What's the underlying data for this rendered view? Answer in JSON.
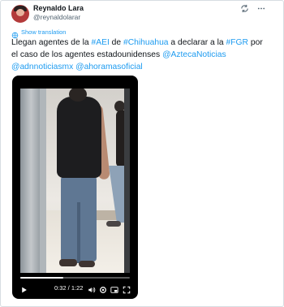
{
  "author": {
    "name": "Reynaldo Lara",
    "handle": "@reynaldolarar"
  },
  "header_icons": [
    "grok-icon",
    "more-icon"
  ],
  "translate": {
    "label": "Show translation"
  },
  "tweet": {
    "parts": [
      {
        "text": "Llegan agentes de la ",
        "link": false
      },
      {
        "text": "#AEI",
        "link": true
      },
      {
        "text": " de ",
        "link": false
      },
      {
        "text": "#Chihuahua",
        "link": true
      },
      {
        "text": " a declarar a la ",
        "link": false
      },
      {
        "text": "#FGR",
        "link": true
      },
      {
        "text": " por el caso de los agentes estadounidenses ",
        "link": false
      },
      {
        "text": "@AztecaNoticias",
        "link": true
      },
      {
        "text": " ",
        "link": false
      },
      {
        "text": "@adnnoticiasmx",
        "link": true
      },
      {
        "text": " ",
        "link": false
      },
      {
        "text": "@ahoramasoficial",
        "link": true
      }
    ]
  },
  "video": {
    "time": "0:32 / 1:22",
    "progress": 0.39,
    "controls": [
      "play-icon",
      "volume-icon",
      "settings-icon",
      "pip-icon",
      "fullscreen-icon"
    ]
  },
  "colors": {
    "link": "#1d9bf0",
    "text": "#0f1419",
    "muted": "#536471"
  }
}
